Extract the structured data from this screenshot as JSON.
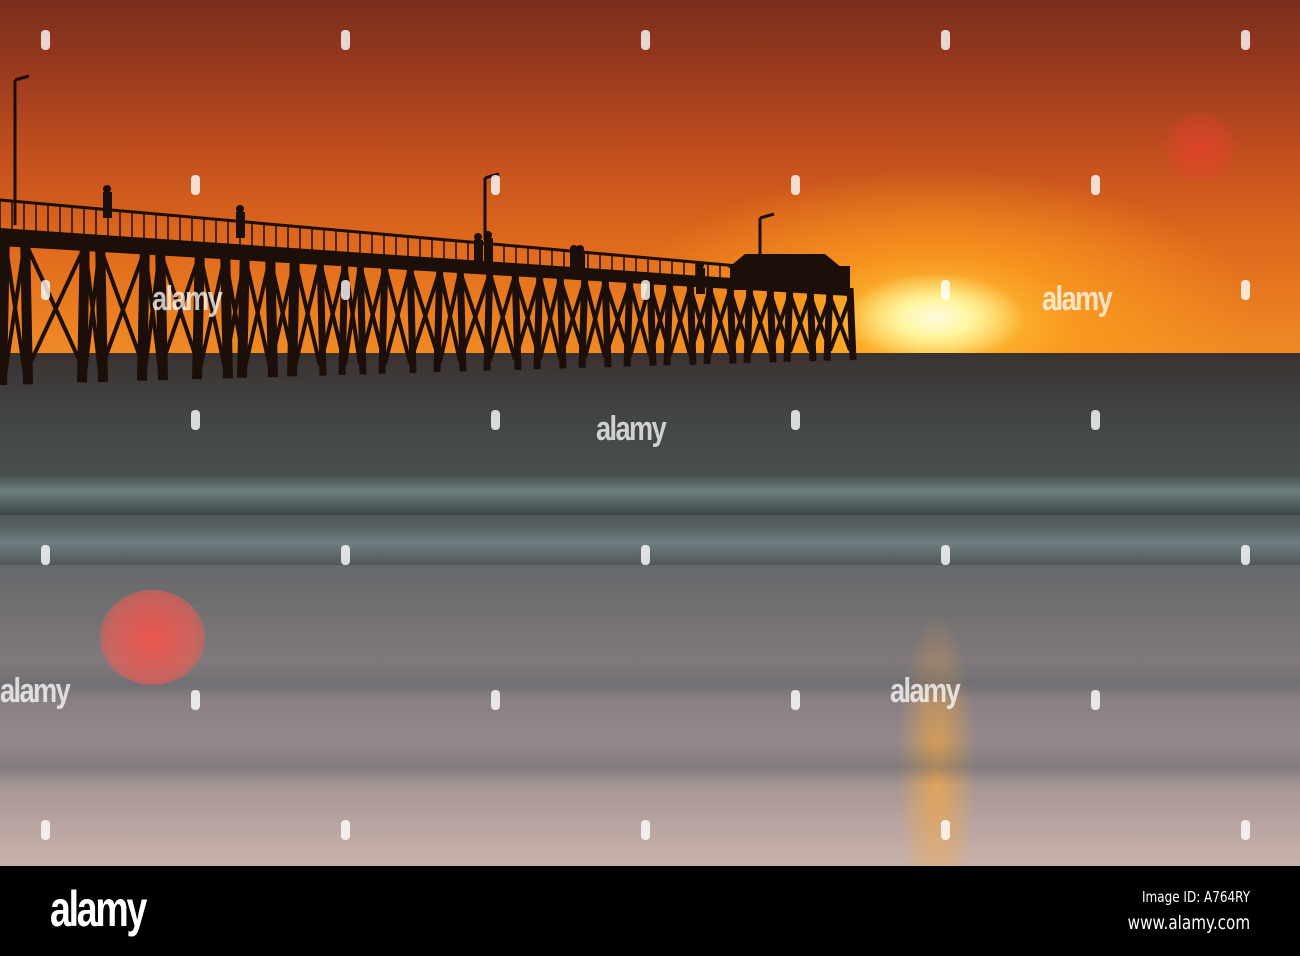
{
  "watermark": {
    "text": "alamy"
  },
  "footer": {
    "logo": "alamy",
    "image_id": "Image ID: A764RY",
    "website": "www.alamy.com"
  },
  "colors": {
    "sky_top": "#7a2e1c",
    "sun": "#fff6a0",
    "sea": "#4a5452",
    "bar": "#000000"
  }
}
